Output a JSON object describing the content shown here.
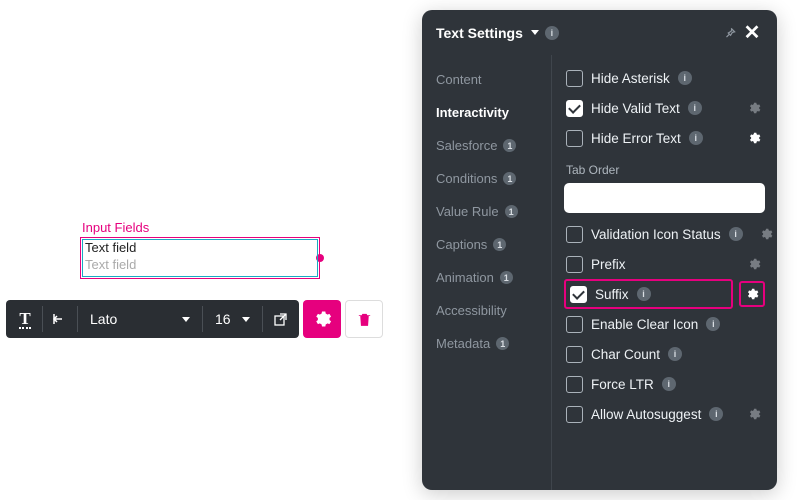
{
  "canvas": {
    "group_label": "Input Fields",
    "field_label": "Text field",
    "field_placeholder": "Text field"
  },
  "toolbar": {
    "font": "Lato",
    "font_size": "16"
  },
  "panel": {
    "title": "Text Settings",
    "nav": [
      {
        "label": "Content",
        "has_badge": false
      },
      {
        "label": "Interactivity",
        "has_badge": false,
        "active": true
      },
      {
        "label": "Salesforce",
        "has_badge": true
      },
      {
        "label": "Conditions",
        "has_badge": true
      },
      {
        "label": "Value Rule",
        "has_badge": true
      },
      {
        "label": "Captions",
        "has_badge": true
      },
      {
        "label": "Animation",
        "has_badge": true
      },
      {
        "label": "Accessibility",
        "has_badge": false
      },
      {
        "label": "Metadata",
        "has_badge": true
      }
    ],
    "tab_order_label": "Tab Order",
    "tab_order_value": "",
    "settings": {
      "hide_asterisk": {
        "label": "Hide Asterisk",
        "checked": false,
        "info": true,
        "gear": null
      },
      "hide_valid_text": {
        "label": "Hide Valid Text",
        "checked": true,
        "info": true,
        "gear": "dim"
      },
      "hide_error_text": {
        "label": "Hide Error Text",
        "checked": false,
        "info": true,
        "gear": "bright"
      },
      "validation_icon": {
        "label": "Validation Icon Status",
        "checked": false,
        "info": true,
        "gear": "dim"
      },
      "prefix": {
        "label": "Prefix",
        "checked": false,
        "info": false,
        "gear": "dim"
      },
      "suffix": {
        "label": "Suffix",
        "checked": true,
        "info": true,
        "gear": "bright",
        "highlight": true
      },
      "enable_clear_icon": {
        "label": "Enable Clear Icon",
        "checked": false,
        "info": true,
        "gear": null
      },
      "char_count": {
        "label": "Char Count",
        "checked": false,
        "info": true,
        "gear": null
      },
      "force_ltr": {
        "label": "Force LTR",
        "checked": false,
        "info": true,
        "gear": null
      },
      "allow_autosuggest": {
        "label": "Allow Autosuggest",
        "checked": false,
        "info": true,
        "gear": "dim"
      }
    }
  }
}
